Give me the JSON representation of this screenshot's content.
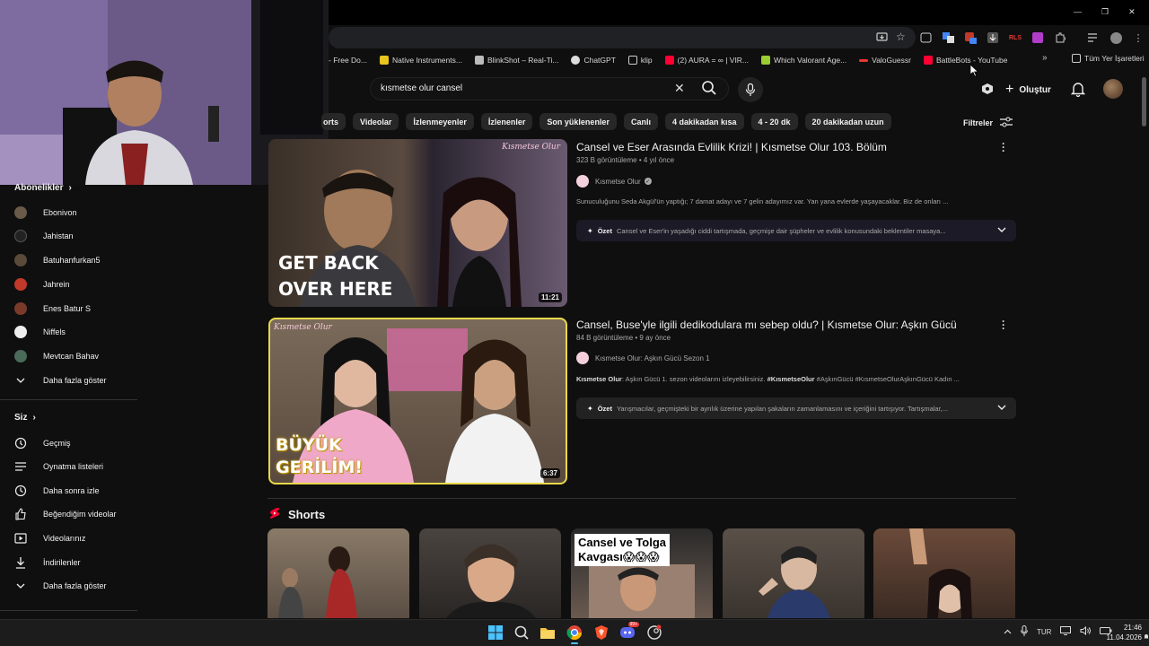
{
  "window": {
    "controls": [
      "—",
      "❐",
      "✕"
    ]
  },
  "bookmarks": [
    {
      "label": "- Free Do...",
      "color": "#f1f1f1"
    },
    {
      "label": "Native Instruments...",
      "color": "#e8c520"
    },
    {
      "label": "BlinkShot – Real-Ti...",
      "color": "#bbbbbb"
    },
    {
      "label": "ChatGPT",
      "color": "#dddddd"
    },
    {
      "label": "klip",
      "color": "#cccccc"
    },
    {
      "label": "(2) AURA = ∞ | VIR...",
      "color": "#ff0033"
    },
    {
      "label": "Which Valorant Age...",
      "color": "#9acd32"
    },
    {
      "label": "ValoGuessr",
      "color": "#e53935"
    },
    {
      "label": "BattleBots - YouTube",
      "color": "#ff0033"
    }
  ],
  "bookmarks_all": "Tüm Yer İşaretleri",
  "search": {
    "query": "kısmetse olur cansel"
  },
  "header": {
    "create_label": "Oluştur"
  },
  "chips": [
    "orts",
    "Videolar",
    "İzlenmeyenler",
    "İzlenenler",
    "Son yüklenenler",
    "Canlı",
    "4 dakikadan kısa",
    "4 - 20 dk",
    "20 dakikadan uzun"
  ],
  "filters_label": "Filtreler",
  "sidebar": {
    "subscriptions_title": "Abonelikler",
    "subscriptions": [
      {
        "label": "Ebonivon",
        "color": "#6a5a4a"
      },
      {
        "label": "Jahistan",
        "color": "#222222"
      },
      {
        "label": "Batuhanfurkan5",
        "color": "#5a4a3a"
      },
      {
        "label": "Jahrein",
        "color": "#c0392b"
      },
      {
        "label": "Enes Batur S",
        "color": "#7a3a2a"
      },
      {
        "label": "Niffels",
        "color": "#eeeeee"
      },
      {
        "label": "Mevtcan Bahav",
        "color": "#4a6a5a"
      }
    ],
    "show_more_1": "Daha fazla göster",
    "you_title": "Siz",
    "you_items": [
      {
        "label": "Geçmiş",
        "icon": "history-icon"
      },
      {
        "label": "Oynatma listeleri",
        "icon": "playlist-icon"
      },
      {
        "label": "Daha sonra izle",
        "icon": "clock-icon"
      },
      {
        "label": "Beğendiğim videolar",
        "icon": "thumbs-up-icon"
      },
      {
        "label": "Videolarınız",
        "icon": "video-icon"
      },
      {
        "label": "İndirilenler",
        "icon": "download-icon"
      }
    ],
    "show_more_2": "Daha fazla göster"
  },
  "results": [
    {
      "title": "Cansel ve Eser Arasında Evlilik Krizi! | Kısmetse Olur 103. Bölüm",
      "meta": "323 B görüntüleme • 4 yıl önce",
      "channel": "Kısmetse Olur",
      "description": "Sunuculuğunu Seda Akgül'ün yaptığı; 7 damat adayı ve 7 gelin adayımız var. Yan yana evlerde yaşayacaklar. Biz de onları ...",
      "summary_label": "Özet",
      "summary": "Cansel ve Eser'in yaşadığı ciddi tartışmada, geçmişe dair şüpheler ve evlilik konusundaki beklentiler masaya...",
      "duration": "11:21",
      "thumb_text_1": "GET BACK",
      "thumb_text_2": "OVER HERE",
      "thumb_logo": "Kısmetse Olur"
    },
    {
      "title": "Cansel, Buse'yle ilgili dedikodulara mı sebep oldu? | Kısmetse Olur: Aşkın Gücü",
      "meta": "84 B görüntüleme • 9 ay önce",
      "channel": "Kısmetse Olur: Aşkın Gücü Sezon 1",
      "description_parts": [
        "Kısmetse Olur",
        ": Aşkın Gücü 1. sezon videolarını izleyebilirsiniz. ",
        "#KısmetseOlur",
        " #AşkınGücü #KısmetseOlurAşkınGücü Kadın ..."
      ],
      "summary_label": "Özet",
      "summary": "Yarışmacılar, geçmişteki bir ayrılık üzerine yapılan şakaların zamanlamasını ve içeriğini tartışıyor. Tartışmalar,...",
      "duration": "6:37",
      "thumb_text_1": "BÜYÜK",
      "thumb_text_2": "GERİLİM!",
      "thumb_logo": "Kısmetse Olur"
    }
  ],
  "shorts_title": "Shorts",
  "shorts": [
    {
      "caption": ""
    },
    {
      "caption": ""
    },
    {
      "caption_1": "Cansel ve Tolga",
      "caption_2": "Kavgası😱😱😱"
    },
    {
      "caption": ""
    },
    {
      "caption": ""
    }
  ],
  "taskbar": {
    "lang": "TUR",
    "time": "21:46",
    "date": "11.04.2026",
    "badge": "99+"
  },
  "colors": {
    "accent_red": "#ff0033",
    "bg": "#0f0f0f",
    "chip": "#272727"
  }
}
